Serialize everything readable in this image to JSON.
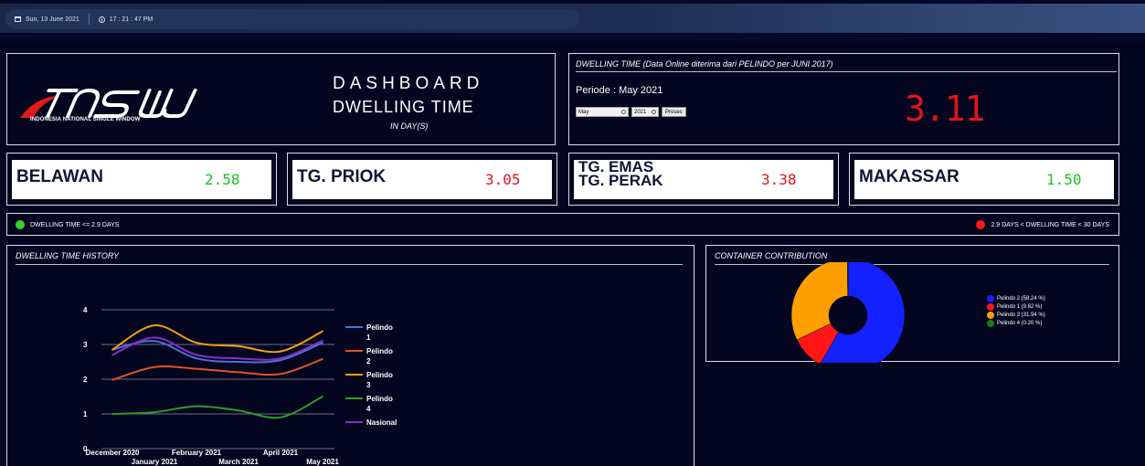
{
  "topbar": {
    "date": "Sun, 13 June 2021",
    "time": "17 : 21 : 47 PM"
  },
  "header": {
    "logo_sub": "INDONESIA NATIONAL SINGLE WINDOW",
    "title": "DASHBOARD",
    "subtitle": "DWELLING TIME",
    "unit": "IN DAY(S)"
  },
  "dwelling": {
    "title": "DWELLING TIME (Data Online diterima dari PELINDO per JUNI 2017)",
    "period": "Periode : May 2021",
    "month": "May",
    "year": "2021",
    "process_label": "Proses",
    "value": "3.11",
    "value_color": "#e0141a"
  },
  "ports": [
    {
      "name": "BELAWAN",
      "value": "2.58",
      "color": "#19c21e"
    },
    {
      "name": "TG. PRIOK",
      "value": "3.05",
      "color": "#e0141a"
    },
    {
      "name": "TG. EMAS",
      "name2": "TG. PERAK",
      "value": "3.38",
      "color": "#e0141a"
    },
    {
      "name": "MAKASSAR",
      "value": "1.50",
      "color": "#19c21e"
    }
  ],
  "legend": {
    "good": "DWELLING TIME <= 2.9 DAYS",
    "good_color": "#3cd22a",
    "bad": "2.9 DAYS < DWELLING TIME < 30 DAYS",
    "bad_color": "#ff1717"
  },
  "history": {
    "title": "DWELLING TIME HISTORY"
  },
  "contribution": {
    "title": "CONTAINER CONTRIBUTION"
  },
  "chart_data": [
    {
      "type": "line",
      "title": "DWELLING TIME HISTORY",
      "x": [
        "December 2020",
        "January 2021",
        "February 2021",
        "March 2021",
        "April 2021",
        "May 2021"
      ],
      "ylim": [
        0,
        4
      ],
      "yticks": [
        "0",
        "1",
        "2",
        "3",
        "4"
      ],
      "grid": true,
      "legend_position": "right",
      "series": [
        {
          "name": "Pelindo 1",
          "color": "#4a72d8",
          "values": [
            2.85,
            3.1,
            2.6,
            2.5,
            2.55,
            3.05
          ]
        },
        {
          "name": "Pelindo 2",
          "color": "#e0532a",
          "values": [
            1.98,
            2.35,
            2.3,
            2.2,
            2.15,
            2.58
          ]
        },
        {
          "name": "Pelindo 3",
          "color": "#f0a010",
          "values": [
            2.85,
            3.55,
            3.05,
            2.95,
            2.8,
            3.38
          ]
        },
        {
          "name": "Pelindo 4",
          "color": "#2c9c2c",
          "values": [
            1.0,
            1.05,
            1.22,
            1.1,
            0.9,
            1.5
          ]
        },
        {
          "name": "Nasional",
          "color": "#8a2ccf",
          "values": [
            2.7,
            3.2,
            2.7,
            2.6,
            2.6,
            3.11
          ]
        }
      ]
    },
    {
      "type": "pie",
      "title": "CONTAINER CONTRIBUTION",
      "donut": true,
      "legend_position": "right",
      "slices": [
        {
          "label": "Pelindo 2 (58.24 %)",
          "value": 58.24,
          "color": "#1421ff"
        },
        {
          "label": "Pelindo 1 (9.62 %)",
          "value": 9.62,
          "color": "#ff1717"
        },
        {
          "label": "Pelindo 3 (31.94 %)",
          "value": 31.94,
          "color": "#ffa000"
        },
        {
          "label": "Pelindo 4 (0.20 %)",
          "value": 0.2,
          "color": "#1e7a1e"
        }
      ]
    }
  ]
}
